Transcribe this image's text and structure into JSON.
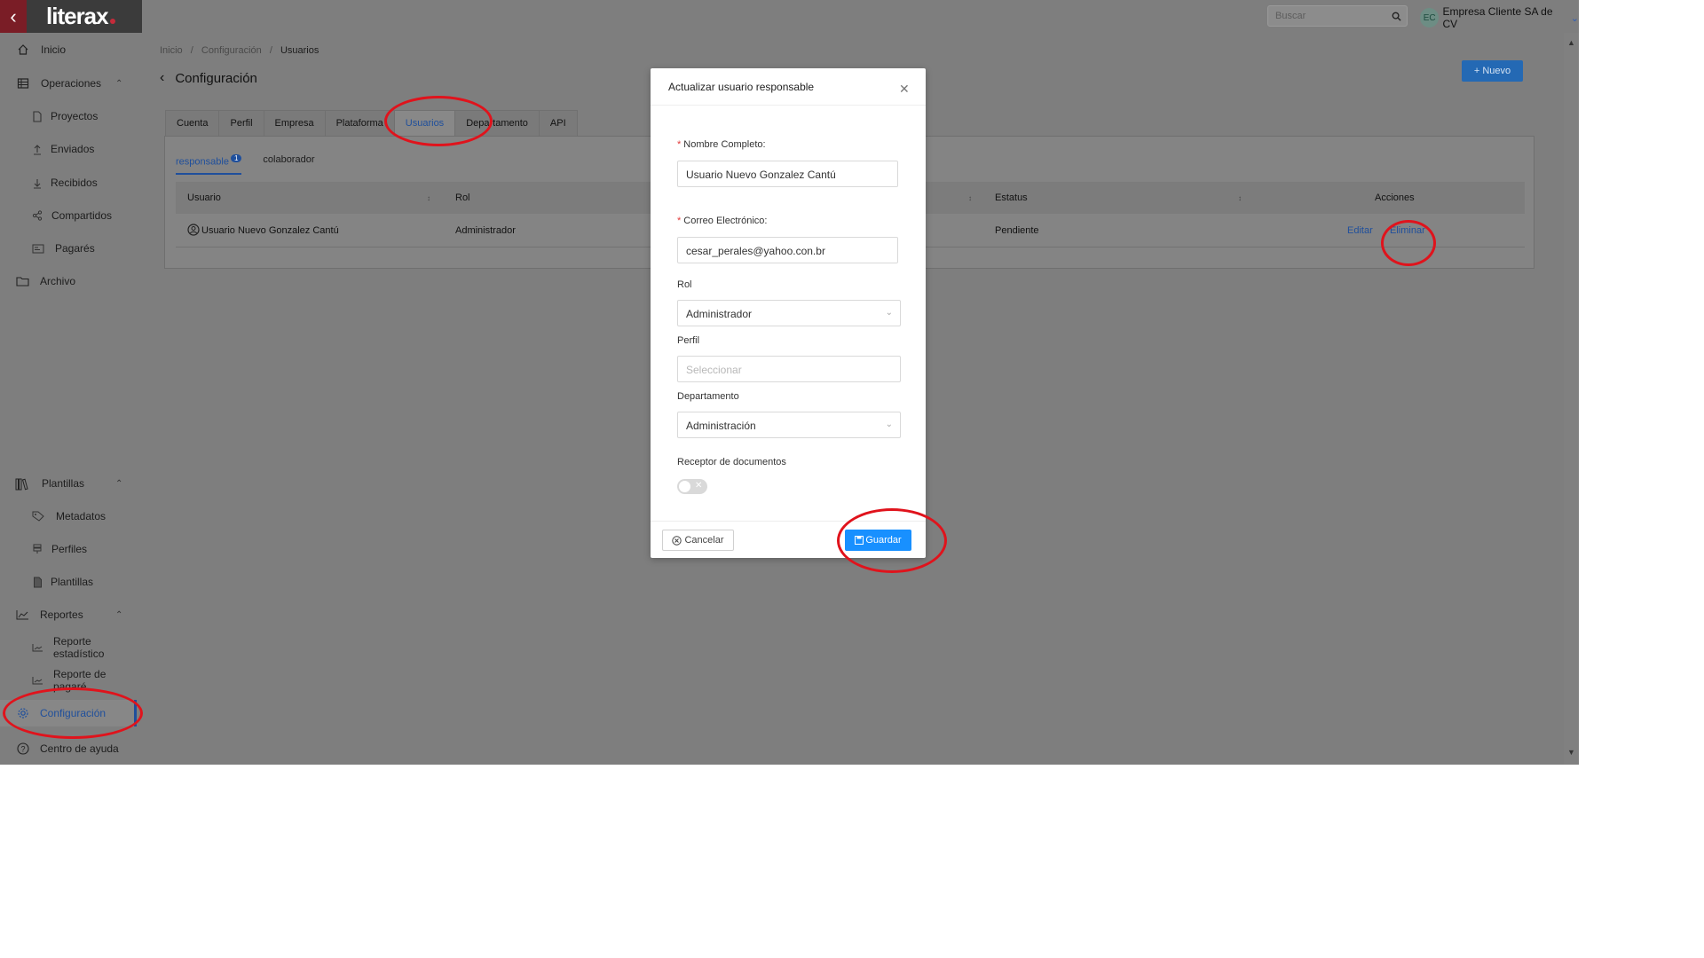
{
  "app": {
    "brand": "literax"
  },
  "topbar": {
    "search_placeholder": "Buscar",
    "company_initials": "EC",
    "company_name": "Empresa Cliente SA de CV"
  },
  "sidebar": {
    "items": [
      {
        "label": "Inicio"
      },
      {
        "label": "Operaciones"
      },
      {
        "label": "Proyectos"
      },
      {
        "label": "Enviados"
      },
      {
        "label": "Recibidos"
      },
      {
        "label": "Compartidos"
      },
      {
        "label": "Pagarés"
      },
      {
        "label": "Archivo"
      },
      {
        "label": "Plantillas"
      },
      {
        "label": "Metadatos"
      },
      {
        "label": "Perfiles"
      },
      {
        "label": "Plantillas"
      },
      {
        "label": "Reportes"
      },
      {
        "label": "Reporte estadístico"
      },
      {
        "label": "Reporte de pagaré"
      },
      {
        "label": "Configuración"
      },
      {
        "label": "Centro de ayuda"
      }
    ]
  },
  "breadcrumb": {
    "home": "Inicio",
    "section": "Configuración",
    "current": "Usuarios",
    "sep": "/"
  },
  "page": {
    "title": "Configuración",
    "new_button": "+ Nuevo"
  },
  "tabs": [
    "Cuenta",
    "Perfil",
    "Empresa",
    "Plataforma",
    "Usuarios",
    "Departamento",
    "API"
  ],
  "subtabs": {
    "responsable": "responsable",
    "responsable_count": "1",
    "colaborador": "colaborador"
  },
  "table": {
    "headers": {
      "usuario": "Usuario",
      "rol": "Rol",
      "estatus": "Estatus",
      "acciones": "Acciones"
    },
    "row": {
      "usuario": "Usuario Nuevo Gonzalez Cantú",
      "rol": "Administrador",
      "estatus": "Pendiente",
      "edit": "Editar",
      "delete": "Eliminar"
    }
  },
  "modal": {
    "title": "Actualizar usuario responsable",
    "name_label": "Nombre Completo",
    "name_value": "Usuario Nuevo Gonzalez Cantú",
    "email_label": "Correo Electrónico",
    "email_value": "cesar_perales@yahoo.con.br",
    "role_label": "Rol",
    "role_value": "Administrador",
    "profile_label": "Perfil",
    "profile_placeholder": "Seleccionar",
    "dept_label": "Departamento",
    "dept_value": "Administración",
    "receiver_label": "Receptor de documentos",
    "cancel": "Cancelar",
    "save": "Guardar"
  },
  "colors": {
    "accent": "#1890ff",
    "brand_red": "#7a1d26",
    "annotation": "#e0131c"
  }
}
